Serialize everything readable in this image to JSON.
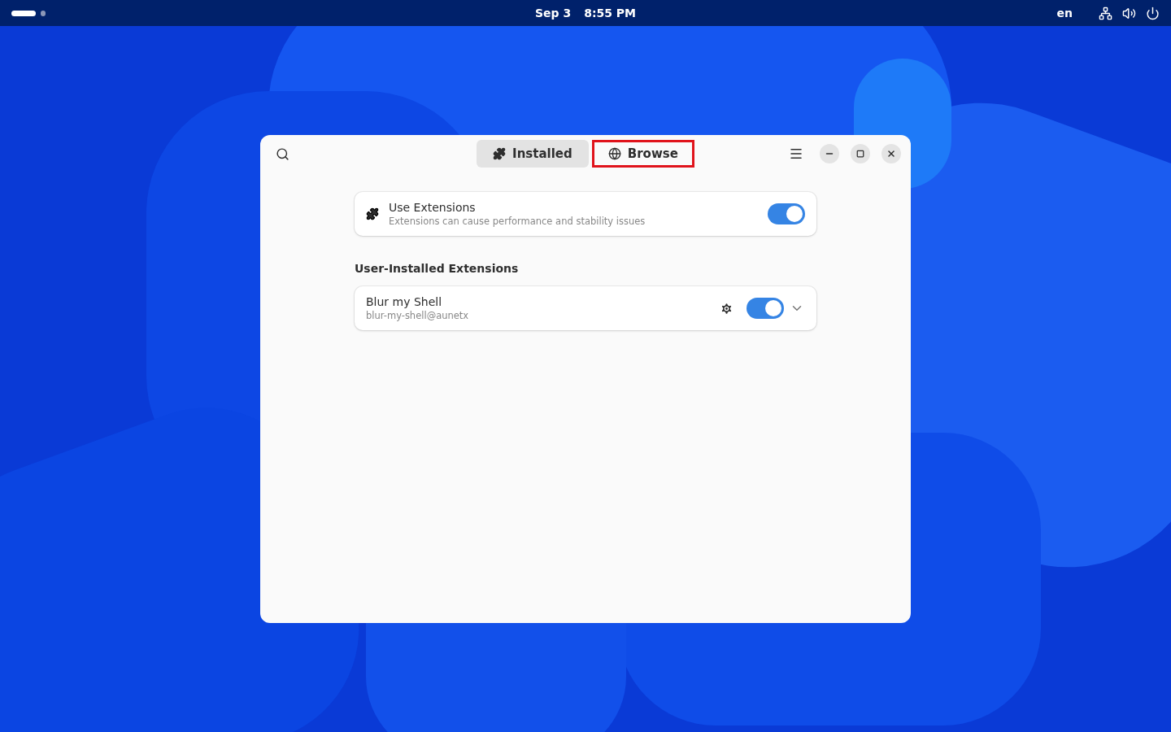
{
  "top_bar": {
    "date": "Sep 3",
    "time": "8:55 PM",
    "keyboard_layout": "en",
    "workspaces": [
      {
        "selected": true
      },
      {
        "selected": false
      }
    ]
  },
  "window": {
    "tabs": [
      {
        "label": "Installed",
        "selected": true,
        "highlighted": false
      },
      {
        "label": "Browse",
        "selected": false,
        "highlighted": true
      }
    ],
    "main_switch": {
      "title": "Use Extensions",
      "subtitle": "Extensions can cause performance and stability issues",
      "on": true
    },
    "section_title": "User-Installed Extensions",
    "extensions": [
      {
        "name": "Blur my Shell",
        "uuid": "blur-my-shell@aunetx",
        "on": true
      }
    ]
  }
}
